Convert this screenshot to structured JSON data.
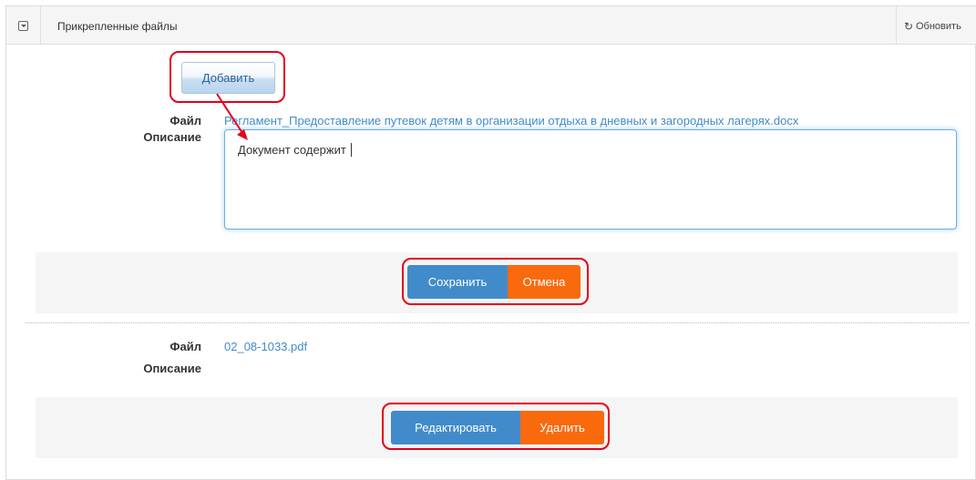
{
  "panel": {
    "title": "Прикрепленные файлы",
    "refresh_label": "Обновить"
  },
  "add_button": "Добавить",
  "edit_form": {
    "file_label": "Файл",
    "file_name": "Регламент_Предоставление путевок детям в организации отдыха в дневных и загородных лагерях.docx",
    "description_label": "Описание",
    "description_value": "Документ содержит",
    "save_label": "Сохранить",
    "cancel_label": "Отмена"
  },
  "file_item": {
    "file_label": "Файл",
    "file_name": "02_08-1033.pdf",
    "description_label": "Описание",
    "edit_label": "Редактировать",
    "delete_label": "Удалить"
  },
  "colors": {
    "primary": "#428bca",
    "danger": "#f96a0e",
    "highlight": "#e3001b"
  },
  "icons": {
    "collapse": "collapse-icon",
    "refresh": "refresh-icon"
  }
}
